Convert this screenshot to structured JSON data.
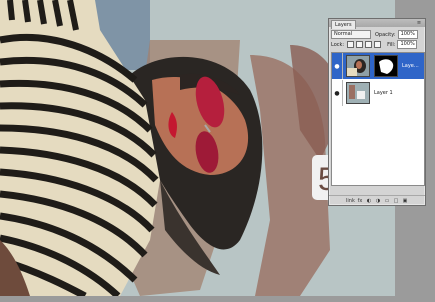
{
  "layers_panel": {
    "tab_label": "Layers",
    "blend_mode": "Normal",
    "opacity_label": "Opacity:",
    "opacity_value": "100%",
    "lock_label": "Lock:",
    "fill_label": "Fill:",
    "fill_value": "100%",
    "layers": [
      {
        "name": "Laye...",
        "selected": true
      },
      {
        "name": "Layer 1",
        "selected": false
      }
    ],
    "footer_link_label": "link"
  },
  "colors": {
    "selection": "#2f65c8",
    "panel_bg": "#d4d4d4",
    "frame_gray": "#9b9b9b"
  },
  "icons": [
    "eye-icon",
    "link-icon",
    "fx-icon",
    "mask-icon",
    "adjustment-icon",
    "folder-icon",
    "new-layer-icon",
    "trash-icon",
    "panel-menu-icon"
  ]
}
